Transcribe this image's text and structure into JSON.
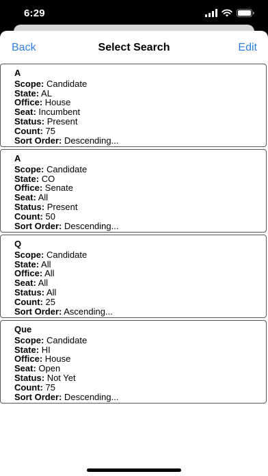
{
  "status": {
    "time": "6:29"
  },
  "nav": {
    "back_label": "Back",
    "title": "Select Search",
    "edit_label": "Edit"
  },
  "labels": {
    "scope": "Scope:",
    "state": "State:",
    "office": "Office:",
    "seat": "Seat:",
    "status": "Status:",
    "count": "Count:",
    "sort_order": "Sort Order:"
  },
  "searches": [
    {
      "name": "A",
      "scope": "Candidate",
      "state": "AL",
      "office": "House",
      "seat": "Incumbent",
      "status": "Present",
      "count": "75",
      "sort_order": "Descending..."
    },
    {
      "name": "A",
      "scope": "Candidate",
      "state": "CO",
      "office": "Senate",
      "seat": "All",
      "status": "Present",
      "count": "50",
      "sort_order": "Descending..."
    },
    {
      "name": "Q",
      "scope": "Candidate",
      "state": "All",
      "office": "All",
      "seat": "All",
      "status": "All",
      "count": "25",
      "sort_order": "Ascending..."
    },
    {
      "name": "Que",
      "scope": "Candidate",
      "state": "HI",
      "office": "House",
      "seat": "Open",
      "status": "Not Yet",
      "count": "75",
      "sort_order": "Descending..."
    }
  ],
  "colors": {
    "accent": "#2f7fe0",
    "card_border": "#555555"
  }
}
